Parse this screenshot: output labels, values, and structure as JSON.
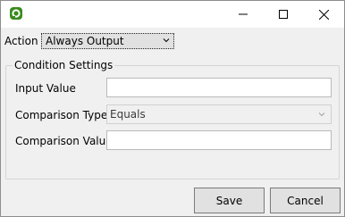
{
  "action": {
    "label": "Action",
    "selected": "Always Output"
  },
  "condition_settings": {
    "title": "Condition Settings",
    "input_value": {
      "label": "Input Value",
      "value": ""
    },
    "comparison_type": {
      "label": "Comparison Type",
      "selected": "Equals"
    },
    "comparison_value": {
      "label": "Comparison Value",
      "value": ""
    }
  },
  "buttons": {
    "save_label": "Save",
    "cancel_label": "Cancel"
  },
  "icons": {
    "app": "app-logo-icon",
    "minimize": "minimize-icon",
    "maximize": "maximize-icon",
    "close": "close-icon",
    "dropdown": "chevron-down-icon"
  },
  "colors": {
    "app_icon": "#3a8b1e",
    "titlebar": "#ffffff",
    "dialog_bg": "#f0f0f0"
  }
}
